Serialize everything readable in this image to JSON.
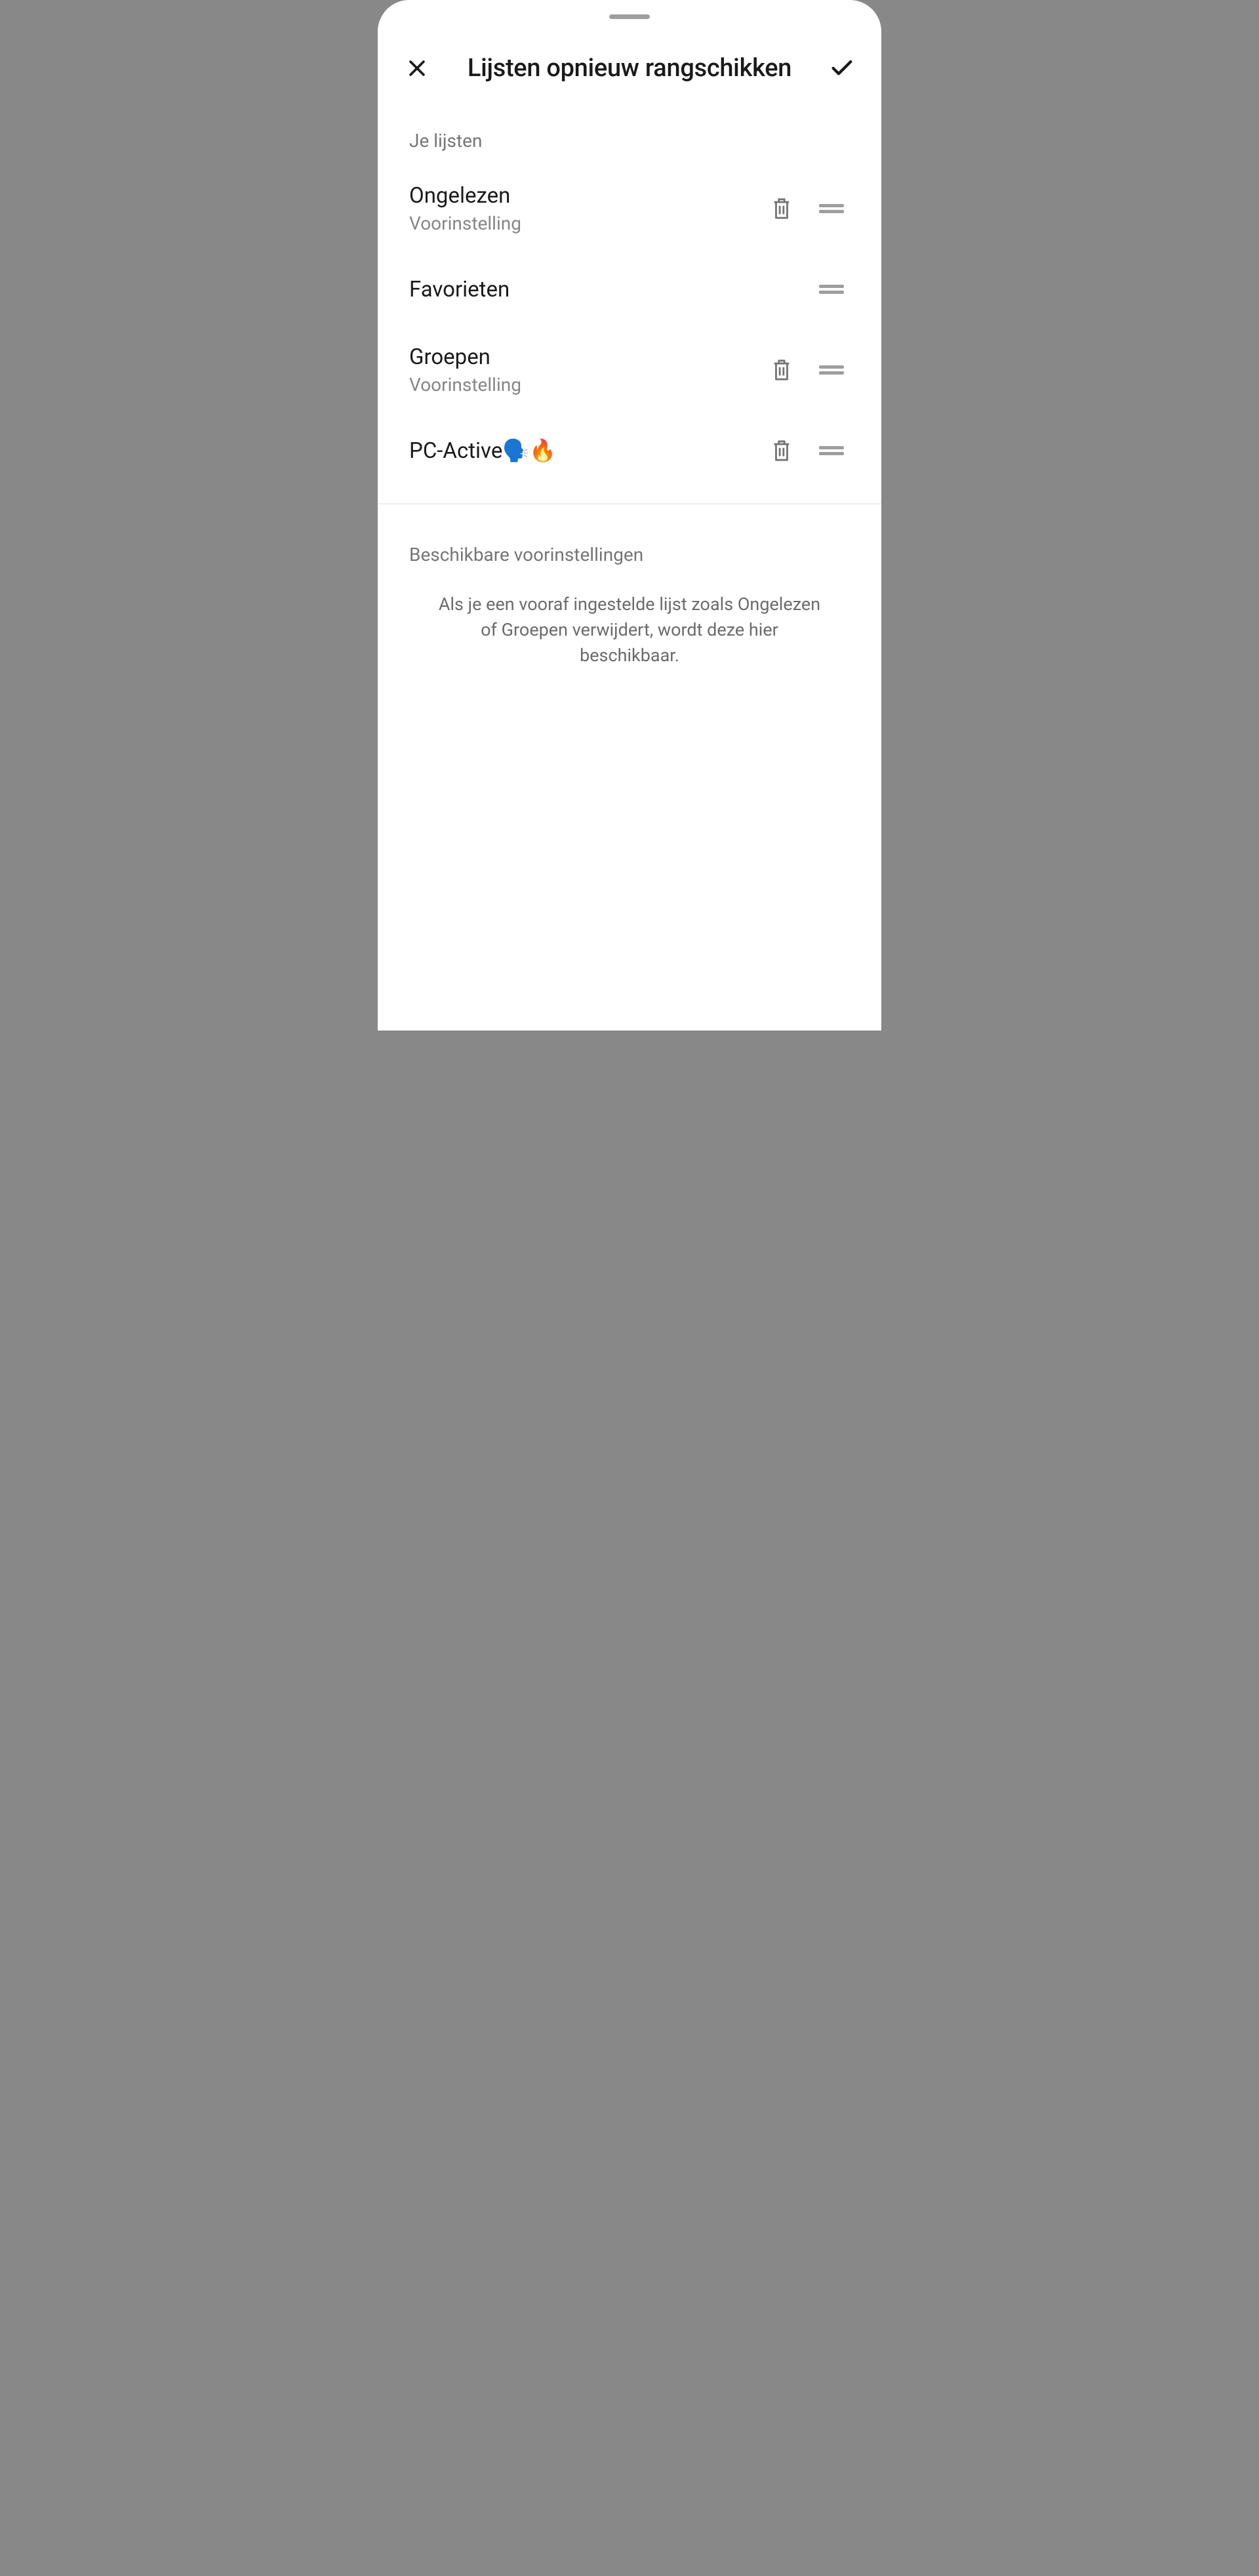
{
  "header": {
    "title": "Lijsten opnieuw rangschikken"
  },
  "sections": {
    "yourLists": {
      "header": "Je lijsten",
      "items": [
        {
          "name": "Ongelezen",
          "subtitle": "Voorinstelling",
          "deletable": true
        },
        {
          "name": "Favorieten",
          "subtitle": "",
          "deletable": false
        },
        {
          "name": "Groepen",
          "subtitle": "Voorinstelling",
          "deletable": true
        },
        {
          "name": "PC-Active🗣️🔥",
          "subtitle": "",
          "deletable": true
        }
      ]
    },
    "presets": {
      "header": "Beschikbare voorinstellingen",
      "hint": "Als je een vooraf ingestelde lijst zoals Ongelezen of Groepen verwijdert, wordt deze hier beschikbaar."
    }
  }
}
